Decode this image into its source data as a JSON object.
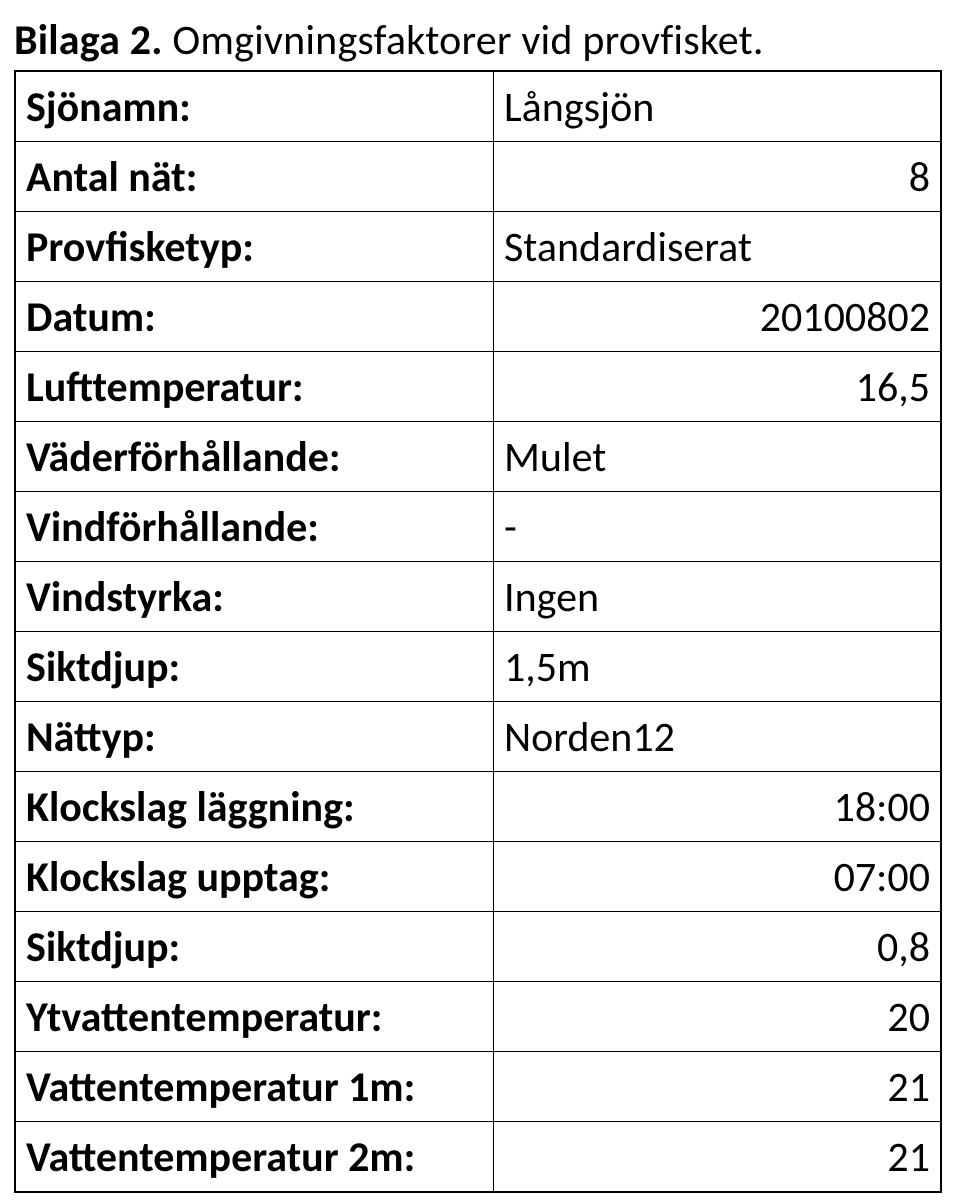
{
  "title": {
    "bold": "Bilaga 2. ",
    "rest": "Omgivningsfaktorer vid provfisket."
  },
  "rows": [
    {
      "key": "Sjönamn:",
      "value": "Långsjön",
      "align": "text"
    },
    {
      "key": "Antal nät:",
      "value": "8",
      "align": "num"
    },
    {
      "key": "Provfisketyp:",
      "value": "Standardiserat",
      "align": "text"
    },
    {
      "key": "Datum:",
      "value": "20100802",
      "align": "num"
    },
    {
      "key": "Lufttemperatur:",
      "value": "16,5",
      "align": "num"
    },
    {
      "key": "Väderförhållande:",
      "value": "Mulet",
      "align": "text"
    },
    {
      "key": "Vindförhållande:",
      "value": "-",
      "align": "text"
    },
    {
      "key": "Vindstyrka:",
      "value": "Ingen",
      "align": "text"
    },
    {
      "key": "Siktdjup:",
      "value": "1,5m",
      "align": "text"
    },
    {
      "key": "Nättyp:",
      "value": "Norden12",
      "align": "text"
    },
    {
      "key": "Klockslag läggning:",
      "value": "18:00",
      "align": "num"
    },
    {
      "key": "Klockslag upptag:",
      "value": "07:00",
      "align": "num"
    },
    {
      "key": "Siktdjup:",
      "value": "0,8",
      "align": "num"
    },
    {
      "key": "Ytvattentemperatur:",
      "value": "20",
      "align": "num"
    },
    {
      "key": "Vattentemperatur 1m:",
      "value": "21",
      "align": "num"
    },
    {
      "key": "Vattentemperatur 2m:",
      "value": "21",
      "align": "num"
    }
  ]
}
